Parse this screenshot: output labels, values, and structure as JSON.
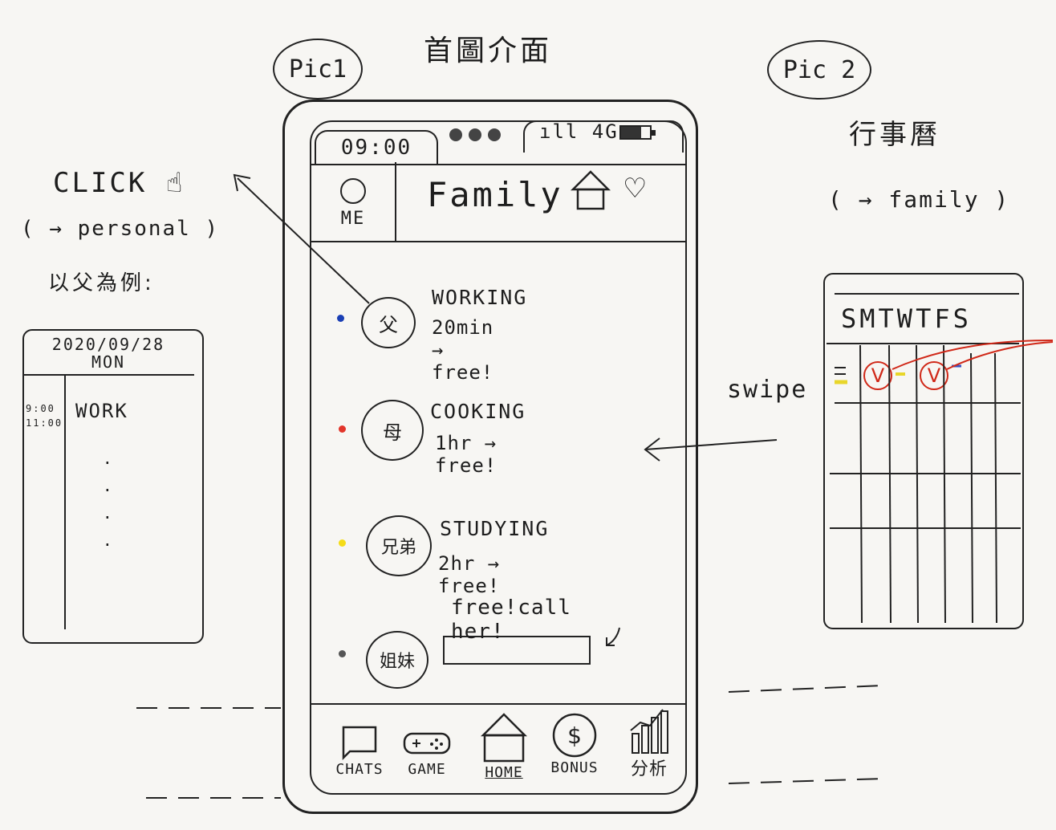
{
  "labels": {
    "pic1": "Pic1",
    "pic2": "Pic 2",
    "home_title": "首圖介面",
    "calendar_title": "行事曆",
    "calendar_target": "( → family )",
    "click": "CLICK",
    "personal_target": "( → personal )",
    "example": "以父為例:",
    "swipe": "swipe"
  },
  "status_bar": {
    "time": "09:00",
    "signal": "ıll 4G",
    "battery_level": 0.7
  },
  "header": {
    "me_label": "ME",
    "title": "Family",
    "house_icon": "house-icon",
    "heart_icon": "heart-icon"
  },
  "members": [
    {
      "avatar": "父",
      "status": "WORKING",
      "free": "20min → free!",
      "dot_color": "#1a3fb5"
    },
    {
      "avatar": "母",
      "status": "COOKING",
      "free": "1hr → free!",
      "dot_color": "#e2352a"
    },
    {
      "avatar": "兄弟",
      "status": "STUDYING",
      "free": "2hr → free!",
      "dot_color": "#f5dc17"
    },
    {
      "avatar": "姐妹",
      "status": "",
      "free": "",
      "dot_color": "#555555"
    }
  ],
  "call_note": "free!call her!",
  "tabs": [
    {
      "label": "CHATS",
      "icon": "chat-bubble-icon"
    },
    {
      "label": "GAME",
      "icon": "gamepad-icon"
    },
    {
      "label": "HOME",
      "icon": "house-icon"
    },
    {
      "label": "BONUS",
      "icon": "dollar-coin-icon"
    },
    {
      "label": "分析",
      "icon": "bar-chart-icon"
    }
  ],
  "personal": {
    "date": "2020/09/28",
    "weekday": "MON",
    "time_start": "9:00",
    "time_end": "11:00",
    "event": "WORK"
  },
  "calendar": {
    "days": "SMTWTFS",
    "check_mark": "V"
  }
}
